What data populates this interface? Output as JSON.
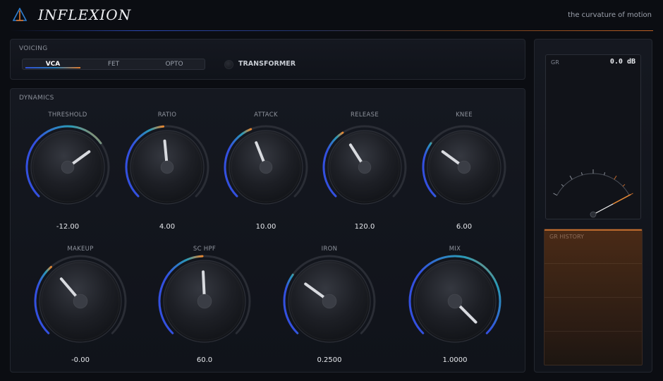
{
  "header": {
    "brand": "INFLEXION",
    "tagline": "the curvature of motion"
  },
  "voicing": {
    "title": "VOICING",
    "modes": [
      "VCA",
      "FET",
      "OPTO"
    ],
    "selected": "VCA",
    "transformer_label": "TRANSFORMER",
    "transformer_on": false
  },
  "dynamics": {
    "title": "DYNAMICS",
    "row1": [
      {
        "id": "threshold",
        "label": "THRESHOLD",
        "value": "-12.00",
        "position": 0.7
      },
      {
        "id": "ratio",
        "label": "RATIO",
        "value": "4.00",
        "position": 0.48
      },
      {
        "id": "attack",
        "label": "ATTACK",
        "value": "10.00",
        "position": 0.42
      },
      {
        "id": "release",
        "label": "RELEASE",
        "value": "120.0",
        "position": 0.38
      },
      {
        "id": "knee",
        "label": "KNEE",
        "value": "6.00",
        "position": 0.3
      }
    ],
    "row2": [
      {
        "id": "makeup",
        "label": "MAKEUP",
        "value": "-0.00",
        "position": 0.35
      },
      {
        "id": "sc-hpf",
        "label": "SC HPF",
        "value": "60.0",
        "position": 0.49
      },
      {
        "id": "iron",
        "label": "IRON",
        "value": "0.2500",
        "position": 0.3
      },
      {
        "id": "mix",
        "label": "MIX",
        "value": "1.0000",
        "position": 1.0
      }
    ]
  },
  "meter": {
    "label": "GR",
    "value": "0.0 dB",
    "history_label": "GR HISTORY",
    "needle_position": 1.0
  },
  "colors": {
    "accent_blue": "#3350e0",
    "accent_teal": "#2a9ab5",
    "accent_orange": "#e8862f"
  }
}
